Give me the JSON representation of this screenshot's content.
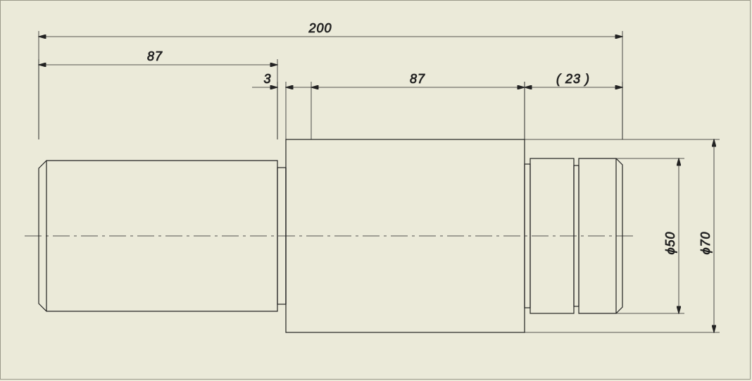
{
  "chart_data": {
    "type": "engineering-drawing",
    "view": "side",
    "overall_length": 200,
    "segments": [
      {
        "length": 87,
        "diameter": null,
        "note": "first shaft segment, chamfered left end"
      },
      {
        "length": 3,
        "diameter": null,
        "note": "relief/undercut groove"
      },
      {
        "length": 87,
        "diameter": 70,
        "note": "large central cylinder Ø70"
      },
      {
        "length": 23,
        "diameter": 50,
        "note": "right end two stepped cylinders Ø50, reference dim"
      }
    ],
    "diameters_called_out": [
      50,
      70
    ]
  },
  "dims": {
    "d200": "200",
    "d87a": "87",
    "d3": "3",
    "d87b": "87",
    "d23": "( 23 )",
    "d50": "ϕ50",
    "d70": "ϕ70"
  }
}
